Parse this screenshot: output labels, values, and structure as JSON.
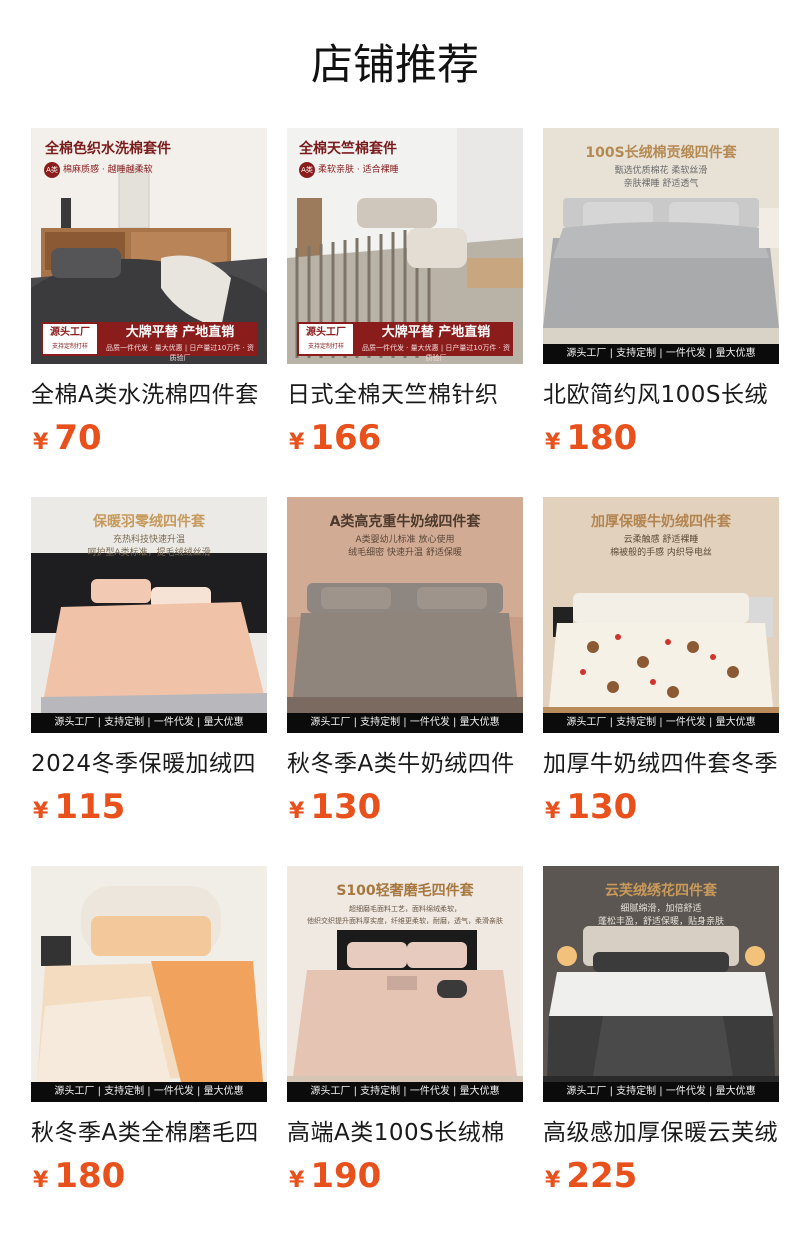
{
  "page_title": "店铺推荐",
  "currency_symbol": "¥",
  "colors": {
    "price": "#e8501c",
    "banner_red": "#8a1c1c",
    "footer_black": "#0b0b0b"
  },
  "products": [
    {
      "name": "全棉A类水洗棉四件套",
      "price": "70",
      "image": {
        "title": "全棉色织水洗棉套件",
        "badge": "A类",
        "sub": "棉麻质感 · 越睡越柔软",
        "banner_left": "源头工厂",
        "banner_left_sub": "支持定制打样",
        "banner_main": "大牌平替  产地直销",
        "banner_small": "品质一件代发 · 量大优惠  |  日产量过10万件 · 资质验厂"
      }
    },
    {
      "name": "日式全棉天竺棉针织",
      "price": "166",
      "image": {
        "title": "全棉天竺棉套件",
        "badge": "A类",
        "sub": "柔软亲肤 · 适合裸睡",
        "banner_left": "源头工厂",
        "banner_left_sub": "支持定制打样",
        "banner_main": "大牌平替  产地直销",
        "banner_small": "品质一件代发 · 量大优惠  |  日产量过10万件 · 资质验厂"
      }
    },
    {
      "name": "北欧简约风100S长绒",
      "price": "180",
      "image": {
        "title": "100S长绒棉贡缎四件套",
        "sub": "甄选优质棉花  柔软丝滑",
        "sub2": "亲肤裸睡  舒适透气",
        "footer": "源头工厂 | 支持定制 | 一件代发 | 量大优惠"
      }
    },
    {
      "name": "2024冬季保暖加绒四",
      "price": "115",
      "image": {
        "title": "保暖羽零绒四件套",
        "sub": "充热科技快速升温",
        "sub2": "呵护型A类标准，提毛绒绒丝滑",
        "footer": "源头工厂 | 支持定制 | 一件代发 | 量大优惠"
      }
    },
    {
      "name": "秋冬季A类牛奶绒四件",
      "price": "130",
      "image": {
        "title": "A类高克重牛奶绒四件套",
        "sub": "A类婴幼儿标准 放心使用",
        "sub2": "绒毛细密 快速升温 舒适保暖",
        "footer": "源头工厂 | 支持定制 | 一件代发 | 量大优惠"
      }
    },
    {
      "name": "加厚牛奶绒四件套冬季",
      "price": "130",
      "image": {
        "title": "加厚保暖牛奶绒四件套",
        "sub": "云柔触感 舒适裸睡",
        "sub2": "棉被般的手感 内织导电丝",
        "footer": "源头工厂 | 支持定制 | 一件代发 | 量大优惠"
      }
    },
    {
      "name": "秋冬季A类全棉磨毛四",
      "price": "180",
      "image": {
        "footer": "源头工厂 | 支持定制 | 一件代发 | 量大优惠"
      }
    },
    {
      "name": "高端A类100S长绒棉",
      "price": "190",
      "image": {
        "title": "S100轻奢磨毛四件套",
        "sub": "超细磨毛面料工艺，面料绵绒柔软，",
        "sub2": "他织交织提升面料厚实度，纤维更柔软，耐磨，透气，柔滑亲肤",
        "footer": "源头工厂 | 支持定制 | 一件代发 | 量大优惠"
      }
    },
    {
      "name": "高级感加厚保暖云芙绒",
      "price": "225",
      "image": {
        "title": "云芙绒绣花四件套",
        "sub": "细腻绵滑，加倍舒适",
        "sub2": "蓬松丰盈，舒适保暖，贴身亲肤",
        "footer": "源头工厂 | 支持定制 | 一件代发 | 量大优惠"
      }
    }
  ]
}
